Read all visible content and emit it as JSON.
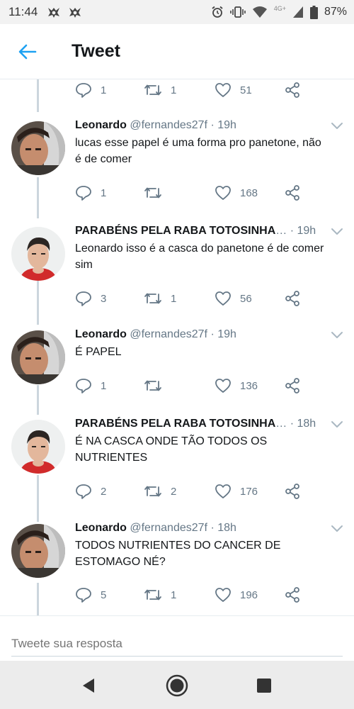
{
  "status_bar": {
    "time": "11:44",
    "network": "4G+",
    "battery": "87%",
    "icons": [
      "app-icon",
      "app-icon",
      "alarm-icon",
      "vibrate-icon",
      "wifi-icon",
      "signal-icon",
      "battery-icon"
    ]
  },
  "header": {
    "title": "Tweet",
    "back_icon": "arrow-left-icon"
  },
  "top_actions": {
    "reply": "1",
    "retweet": "1",
    "like": "51"
  },
  "tweets": [
    {
      "name": "Leonardo",
      "handle": "@fernandes27f",
      "time": "· 19h",
      "text": "lucas esse papel é uma forma pro panetone, não é de comer",
      "reply": "1",
      "retweet": "",
      "like": "168"
    },
    {
      "name": "PARABÉNS PELA RABA TOTOSINHA",
      "handle": "",
      "time": "… · 19h",
      "text": "Leonardo isso é a casca do panetone é de comer sim",
      "reply": "3",
      "retweet": "1",
      "like": "56"
    },
    {
      "name": "Leonardo",
      "handle": "@fernandes27f",
      "time": "· 19h",
      "text": "É PAPEL",
      "reply": "1",
      "retweet": "",
      "like": "136"
    },
    {
      "name": "PARABÉNS PELA RABA TOTOSINHA",
      "handle": "",
      "time": "… · 18h",
      "text": "É NA CASCA ONDE TÃO TODOS OS NUTRIENTES",
      "reply": "2",
      "retweet": "2",
      "like": "176"
    },
    {
      "name": "Leonardo",
      "handle": "@fernandes27f",
      "time": "· 18h",
      "text": "TODOS NUTRIENTES DO CANCER DE ESTOMAGO NÉ?",
      "reply": "5",
      "retweet": "1",
      "like": "196"
    }
  ],
  "reply_box": {
    "placeholder": "Tweete sua resposta"
  },
  "colors": {
    "accent": "#1da1f2",
    "text": "#14171a",
    "secondary": "#657786",
    "line": "#ccd6dd"
  }
}
